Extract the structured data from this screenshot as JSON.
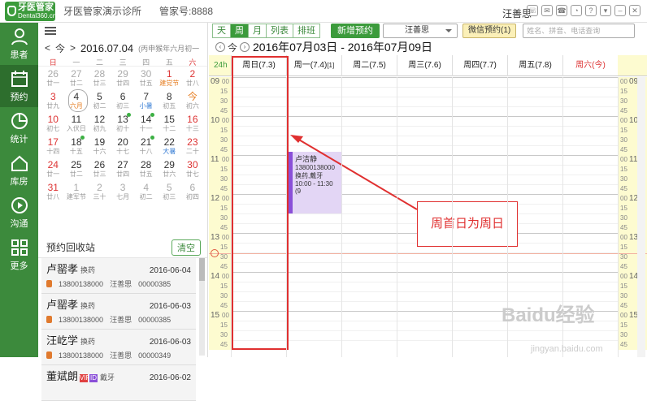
{
  "titlebar": {
    "logo_main": "牙医管家",
    "logo_sub": "Dental360.cn",
    "clinic": "牙医管家演示诊所",
    "manager_no": "管家号:8888",
    "user": "汪善思"
  },
  "sidebar": [
    {
      "label": "患者",
      "icon": "user-icon"
    },
    {
      "label": "预约",
      "icon": "calendar-icon",
      "active": true
    },
    {
      "label": "统计",
      "icon": "pie-chart-icon"
    },
    {
      "label": "库房",
      "icon": "house-icon"
    },
    {
      "label": "沟通",
      "icon": "play-circle-icon"
    },
    {
      "label": "更多",
      "icon": "grid-icon"
    }
  ],
  "calendar": {
    "prev": "<",
    "today": "今",
    "next": ">",
    "date": "2016.07.04",
    "lunar": "(丙申猴年六月初一",
    "weekdays": [
      "日",
      "一",
      "二",
      "三",
      "四",
      "五",
      "六"
    ],
    "days": [
      {
        "n": "26",
        "l": "廿一",
        "c": "gray"
      },
      {
        "n": "27",
        "l": "廿二",
        "c": "gray"
      },
      {
        "n": "28",
        "l": "廿三",
        "c": "gray"
      },
      {
        "n": "29",
        "l": "廿四",
        "c": "gray"
      },
      {
        "n": "30",
        "l": "廿五",
        "c": "gray"
      },
      {
        "n": "1",
        "l": "建党节",
        "c": "we",
        "lc": "hol"
      },
      {
        "n": "2",
        "l": "廿八",
        "c": "we"
      },
      {
        "n": "3",
        "l": "廿九",
        "c": "we"
      },
      {
        "n": "4",
        "l": "六月",
        "c": "sel",
        "lc": "hol"
      },
      {
        "n": "5",
        "l": "初二"
      },
      {
        "n": "6",
        "l": "初三"
      },
      {
        "n": "7",
        "l": "小暑",
        "lc": "blue"
      },
      {
        "n": "8",
        "l": "初五"
      },
      {
        "n": "今",
        "l": "初六",
        "c": "today"
      },
      {
        "n": "10",
        "l": "初七",
        "c": "we"
      },
      {
        "n": "11",
        "l": "入伏日"
      },
      {
        "n": "12",
        "l": "初九"
      },
      {
        "n": "13",
        "l": "初十",
        "dot": true
      },
      {
        "n": "14",
        "l": "十一",
        "dot": true
      },
      {
        "n": "15",
        "l": "十二"
      },
      {
        "n": "16",
        "l": "十三",
        "c": "we"
      },
      {
        "n": "17",
        "l": "十四",
        "c": "we"
      },
      {
        "n": "18",
        "l": "十五",
        "dot": true
      },
      {
        "n": "19",
        "l": "十六"
      },
      {
        "n": "20",
        "l": "十七"
      },
      {
        "n": "21",
        "l": "十八",
        "dot": true
      },
      {
        "n": "22",
        "l": "大暑",
        "lc": "blue"
      },
      {
        "n": "23",
        "l": "二十",
        "c": "we"
      },
      {
        "n": "24",
        "l": "廿一",
        "c": "we"
      },
      {
        "n": "25",
        "l": "廿二"
      },
      {
        "n": "26",
        "l": "廿三"
      },
      {
        "n": "27",
        "l": "廿四"
      },
      {
        "n": "28",
        "l": "廿五"
      },
      {
        "n": "29",
        "l": "廿六"
      },
      {
        "n": "30",
        "l": "廿七",
        "c": "we"
      },
      {
        "n": "31",
        "l": "廿八",
        "c": "we"
      },
      {
        "n": "1",
        "l": "建军节",
        "c": "gray"
      },
      {
        "n": "2",
        "l": "三十",
        "c": "gray"
      },
      {
        "n": "3",
        "l": "七月",
        "c": "gray"
      },
      {
        "n": "4",
        "l": "初二",
        "c": "gray"
      },
      {
        "n": "5",
        "l": "初三",
        "c": "gray"
      },
      {
        "n": "6",
        "l": "初四",
        "c": "gray"
      }
    ]
  },
  "recycle": {
    "title": "预约回收站",
    "clear": "清空",
    "items": [
      {
        "name": "卢罂孝",
        "type": "换药",
        "date": "2016-06-04",
        "phone": "13800138000",
        "doctor": "汪善思",
        "code": "00000385"
      },
      {
        "name": "卢罂孝",
        "type": "换药",
        "date": "2016-06-03",
        "phone": "13800138000",
        "doctor": "汪善思",
        "code": "00000385"
      },
      {
        "name": "汪屹学",
        "type": "换药",
        "date": "2016-06-03",
        "phone": "13800138000",
        "doctor": "汪善思",
        "code": "00000349"
      },
      {
        "name": "董斌朗",
        "type": "戴牙",
        "date": "2016-06-02",
        "badges": [
          "VIP",
          "ID"
        ]
      }
    ]
  },
  "toolbar": {
    "views": [
      "天",
      "周",
      "月",
      "列表",
      "排班"
    ],
    "active_view": "周",
    "new_appt": "新增预约",
    "doctor": "汪善思",
    "wechat": "微信预约(1)",
    "search_placeholder": "姓名、拼音、电话查询"
  },
  "datebar": {
    "today": "今",
    "range": "2016年07月03日 - 2016年07月09日"
  },
  "grid": {
    "corner": "24h",
    "days": [
      "周日(7.3)",
      "周一(7.4)",
      "周二(7.5)",
      "周三(7.6)",
      "周四(7.7)",
      "周五(7.8)",
      "周六(今)"
    ],
    "monday_suffix": "[1]",
    "hours": [
      "09",
      "10",
      "11",
      "12",
      "13",
      "14",
      "15"
    ],
    "quarters": [
      "00",
      "15",
      "30",
      "45"
    ]
  },
  "appointment": {
    "name": "卢洁静",
    "phone": "13800138000",
    "type": "换药,戴牙",
    "time": "10:00 - 11:30 (9"
  },
  "annotation": "周首日为周日",
  "watermark": "Baidu经验",
  "watermark_sub": "jingyan.baidu.com",
  "colors": {
    "brand": "#3c9b3c",
    "sidebar": "#3c8a3c",
    "annot": "#e03030",
    "appt": "#8a4fd8"
  }
}
